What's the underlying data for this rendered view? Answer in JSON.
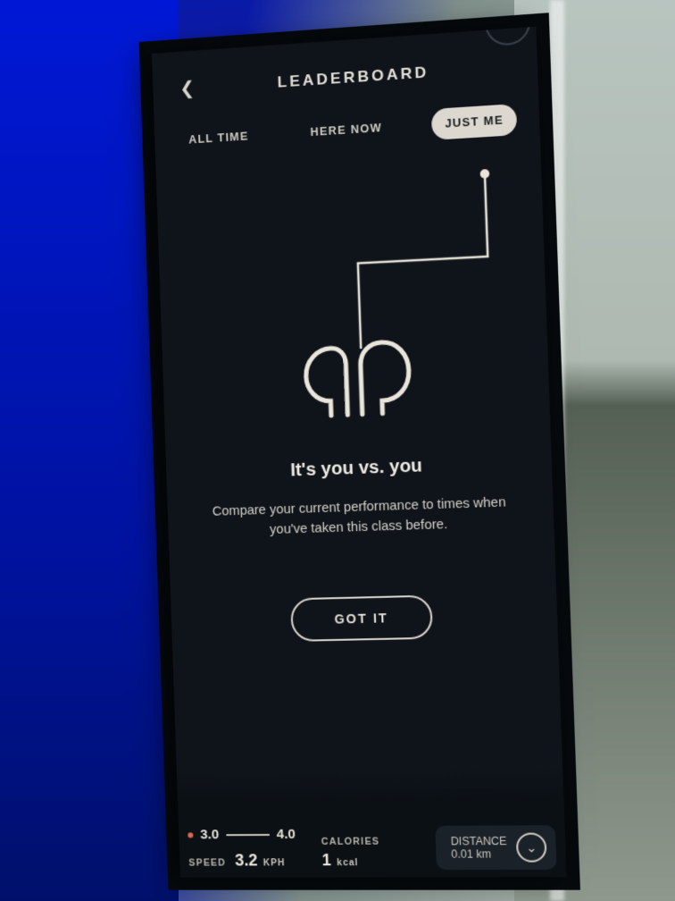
{
  "header": {
    "title": "LEADERBOARD"
  },
  "tabs": [
    {
      "label": "ALL TIME",
      "active": false
    },
    {
      "label": "HERE NOW",
      "active": false
    },
    {
      "label": "JUST ME",
      "active": true
    }
  ],
  "message": {
    "title": "It's you vs. you",
    "body": "Compare your current performance to times when you've taken this class before.",
    "cta": "GOT IT"
  },
  "metrics": {
    "incline_low": "3.0",
    "incline_high": "4.0",
    "speed": {
      "label": "SPEED",
      "value": "3.2",
      "unit": "KPH"
    },
    "calories": {
      "label": "CALORIES",
      "value": "1",
      "unit": "kcal"
    },
    "distance": {
      "label": "DISTANCE",
      "value": "0.01",
      "unit": "km"
    }
  }
}
